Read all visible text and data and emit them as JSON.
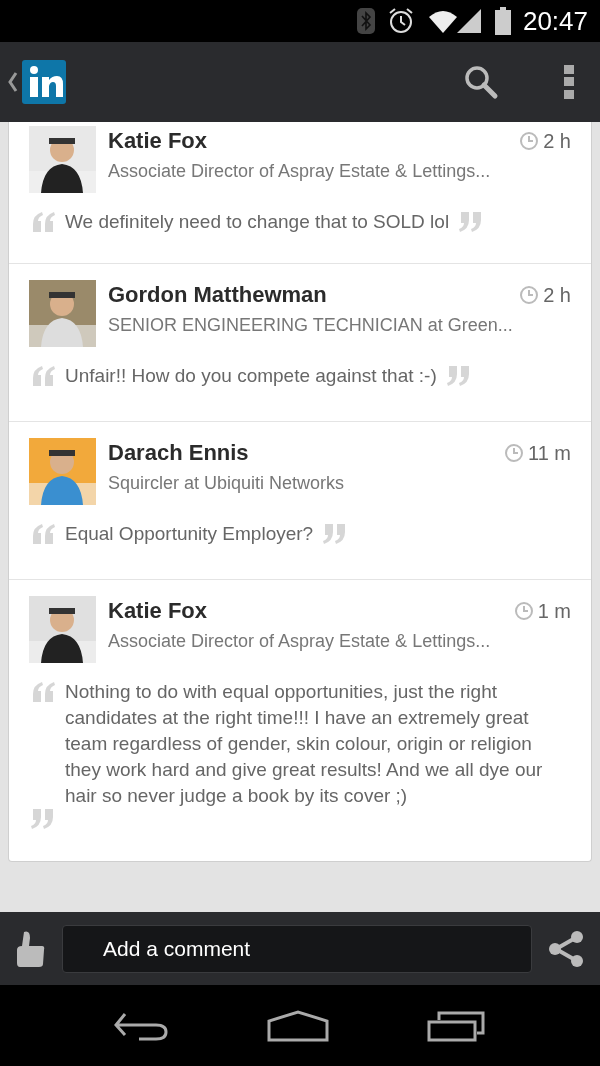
{
  "status_bar": {
    "time": "20:47"
  },
  "comments": [
    {
      "name": "Katie Fox",
      "title": "Associate Director of Aspray Estate & Lettings...",
      "time": "2 h",
      "text": "We definitely need to change that to SOLD lol"
    },
    {
      "name": "Gordon Matthewman",
      "title": "SENIOR ENGINEERING TECHNICIAN at Green...",
      "time": "2 h",
      "text": "Unfair!! How do you compete against that :-)"
    },
    {
      "name": "Darach Ennis",
      "title": "Squircler at Ubiquiti Networks",
      "time": "11 m",
      "text": "Equal Opportunity Employer?"
    },
    {
      "name": "Katie Fox",
      "title": "Associate Director of Aspray Estate & Lettings...",
      "time": "1 m",
      "text": "Nothing to do with equal opportunities, just the right candidates at the right time!!! I have an extremely great team regardless of gender, skin colour, origin or religion they work hard and give great results! And we all dye our hair so never judge a book by its cover ;)"
    }
  ],
  "comment_field": {
    "placeholder": "Add a comment"
  }
}
